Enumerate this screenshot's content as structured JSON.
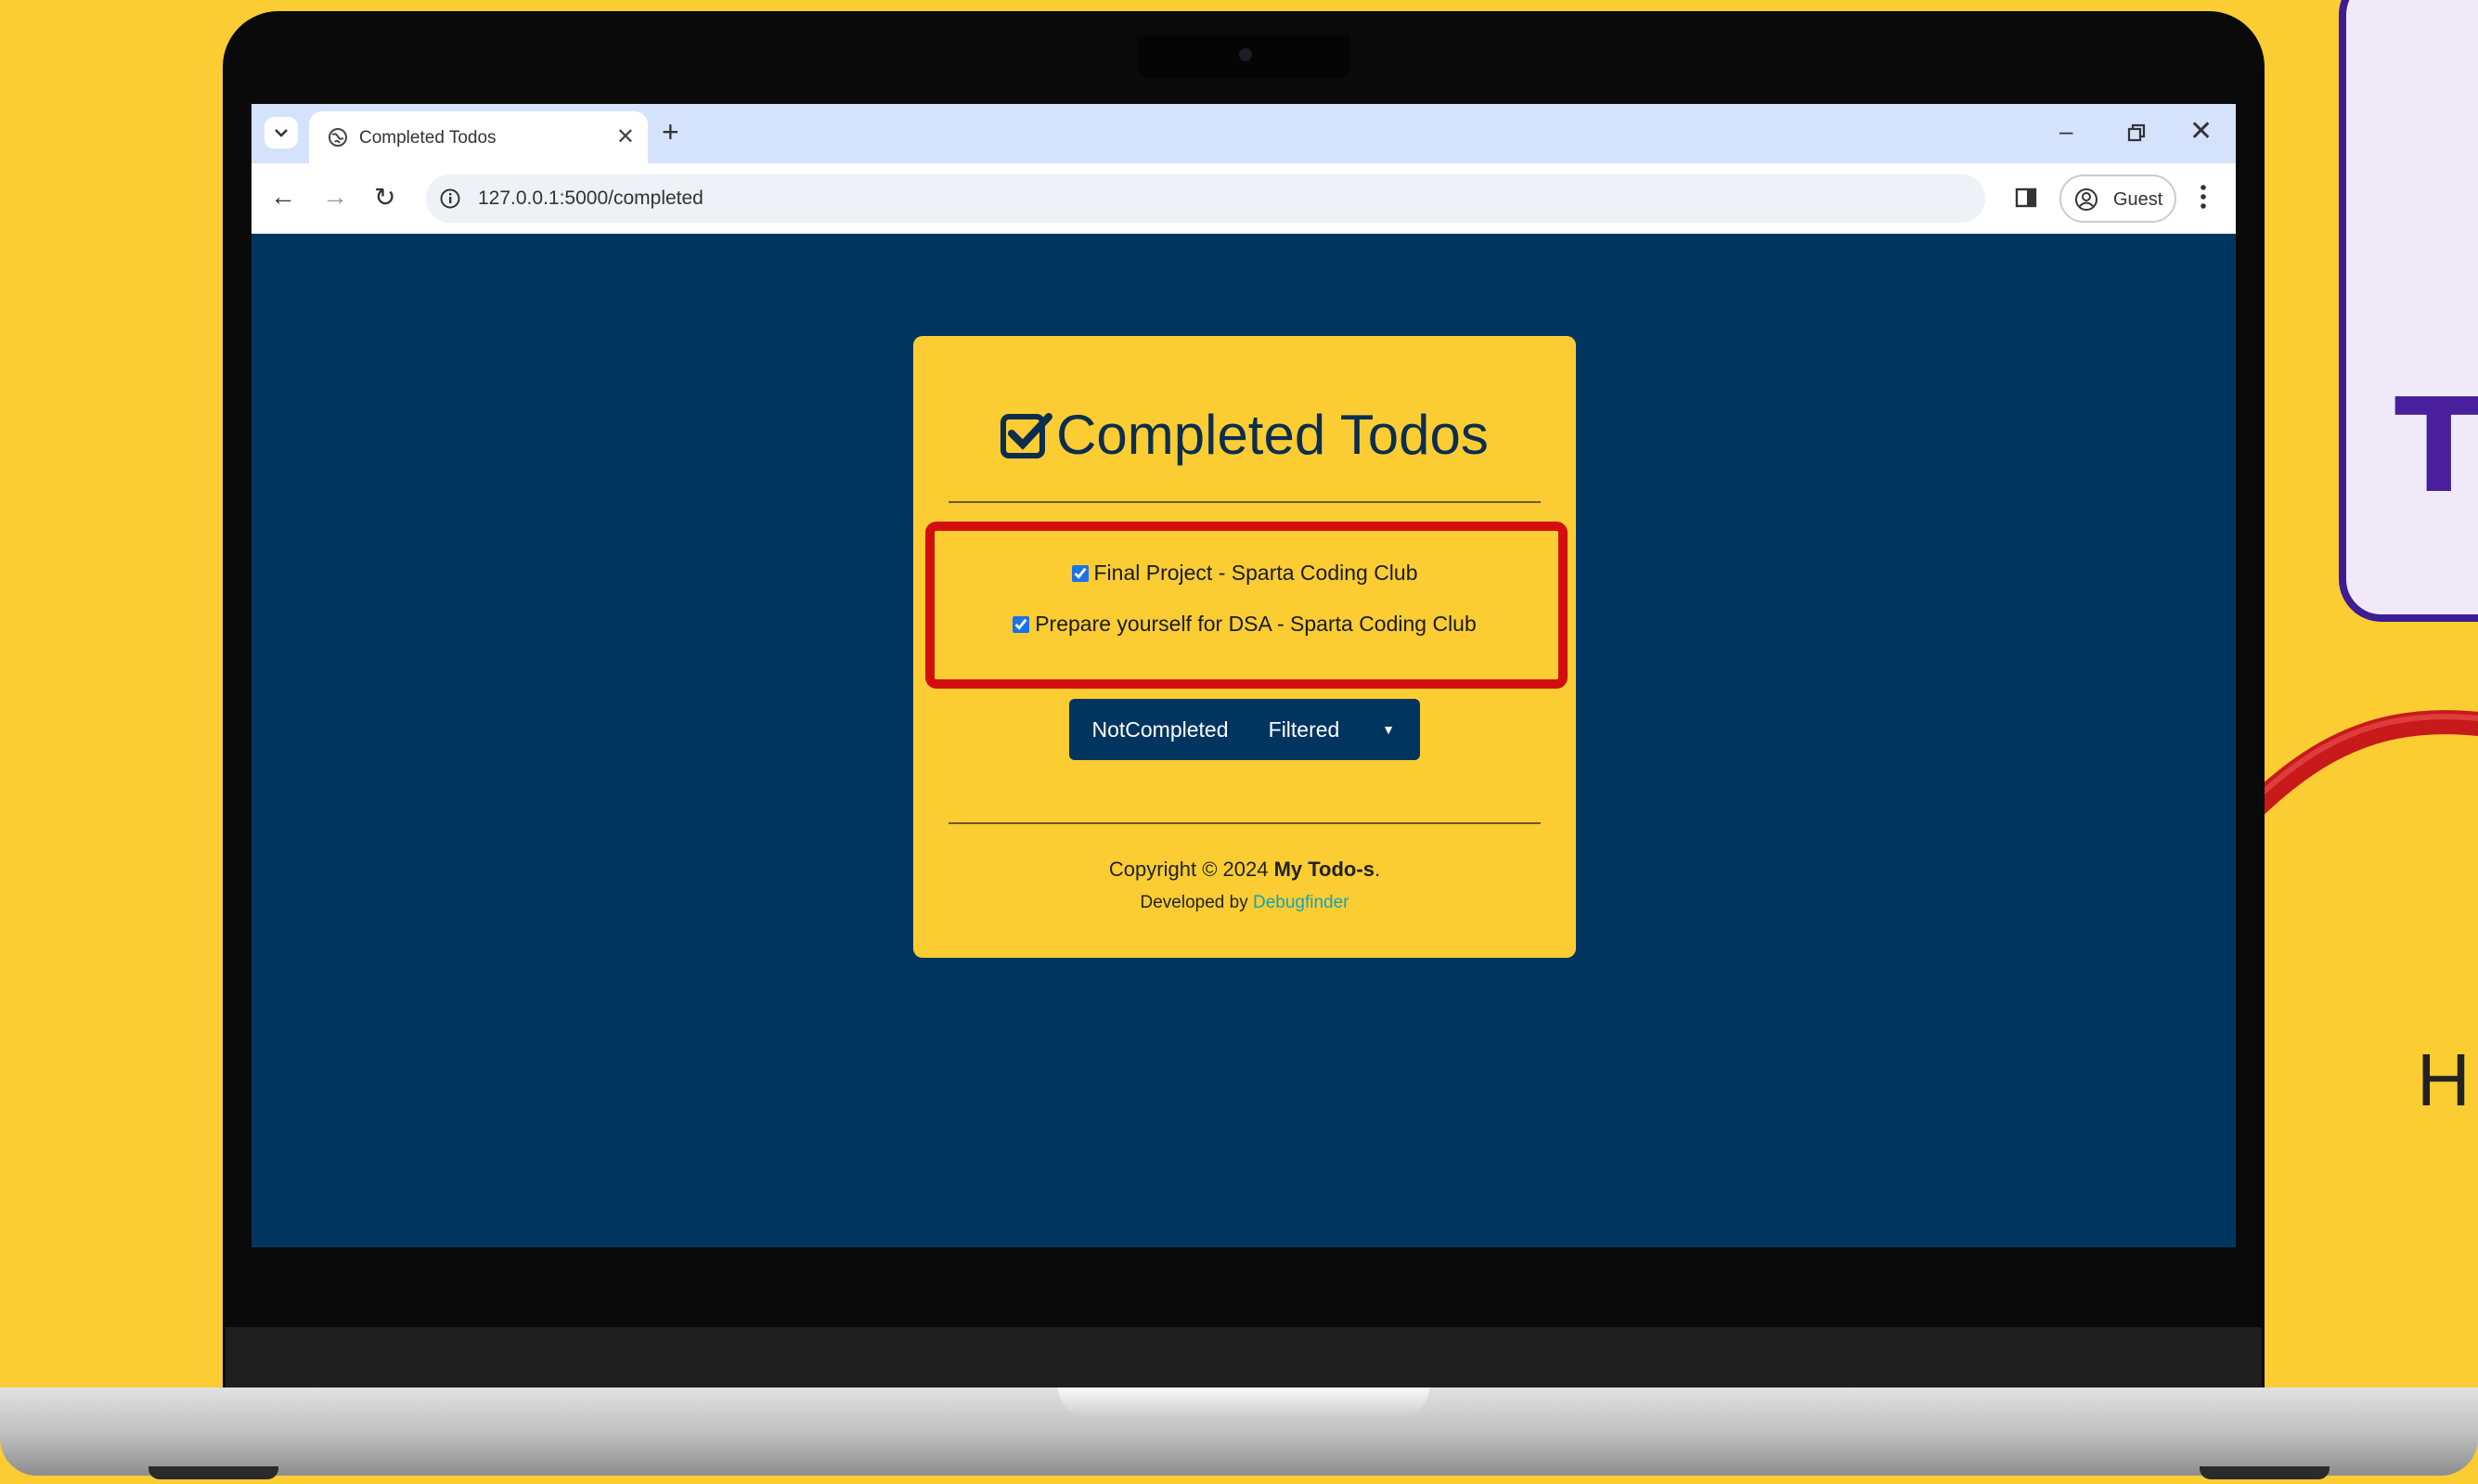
{
  "browser": {
    "tab_title": "Completed Todos",
    "new_tab_label": "+",
    "url": "127.0.0.1:5000/completed",
    "profile_label": "Guest"
  },
  "card": {
    "title": "Completed Todos",
    "todos": [
      {
        "label": "Final Project - Sparta Coding Club",
        "checked": true
      },
      {
        "label": "Prepare yourself for DSA - Sparta Coding Club",
        "checked": true
      }
    ],
    "buttons": {
      "not_completed": "NotCompleted",
      "filtered": "Filtered"
    },
    "footer": {
      "copyright_prefix": "Copyright © 2024 ",
      "brand": "My Todo-s",
      "copyright_suffix": ".",
      "developed_prefix": "Developed by ",
      "developer": "Debugfinder"
    }
  },
  "decor": {
    "right_letter": "T",
    "right_bottom_letter": "H"
  },
  "colors": {
    "background": "#FBCD33",
    "screen": "#003560",
    "highlight": "#d30e0e",
    "link": "#17a2b8"
  }
}
